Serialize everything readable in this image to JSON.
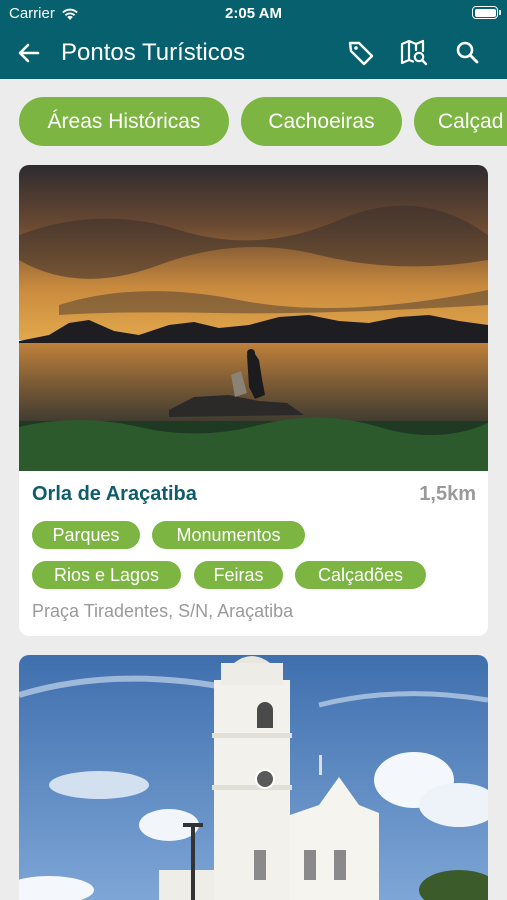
{
  "status_bar": {
    "carrier": "Carrier",
    "time": "2:05 AM"
  },
  "header": {
    "title": "Pontos Turísticos",
    "back_icon": "arrow-left-icon",
    "actions": [
      "tag-icon",
      "map-search-icon",
      "search-icon"
    ]
  },
  "categories": [
    "Áreas Históricas",
    "Cachoeiras",
    "Calçad"
  ],
  "places": [
    {
      "name": "Orla de Araçatiba",
      "distance": "1,5km",
      "tags": [
        "Parques",
        "Monumentos",
        "Rios e Lagos",
        "Feiras",
        "Calçadões"
      ],
      "address": "Praça Tiradentes, S/N, Araçatiba"
    }
  ],
  "colors": {
    "header": "#06606e",
    "chip": "#7cb542",
    "place_name": "#0f5c6b",
    "muted": "#9a9a9a",
    "background": "#ececec"
  }
}
